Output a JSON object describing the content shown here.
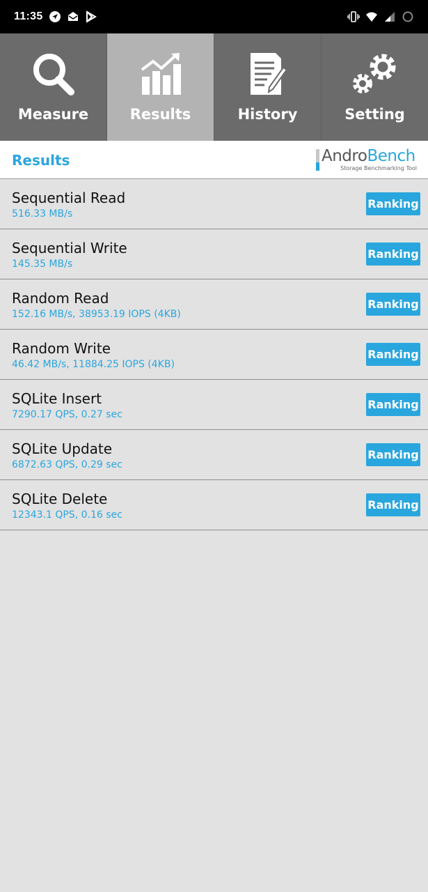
{
  "status_bar": {
    "time": "11:35",
    "icons_left": [
      "navigation-icon",
      "mail-icon",
      "play-store-icon"
    ],
    "icons_right": [
      "vibrate-icon",
      "wifi-icon",
      "signal-icon",
      "battery-icon"
    ]
  },
  "tabs": [
    {
      "label": "Measure",
      "icon": "magnifier-icon",
      "active": false
    },
    {
      "label": "Results",
      "icon": "chart-icon",
      "active": true
    },
    {
      "label": "History",
      "icon": "document-icon",
      "active": false
    },
    {
      "label": "Setting",
      "icon": "gears-icon",
      "active": false
    }
  ],
  "header": {
    "title": "Results",
    "logo_andro": "Andro",
    "logo_bench": "Bench",
    "logo_tagline": "Storage Benchmarking Tool"
  },
  "results": [
    {
      "name": "Sequential Read",
      "value": "516.33 MB/s",
      "button": "Ranking"
    },
    {
      "name": "Sequential Write",
      "value": "145.35 MB/s",
      "button": "Ranking"
    },
    {
      "name": "Random Read",
      "value": "152.16 MB/s, 38953.19 IOPS (4KB)",
      "button": "Ranking"
    },
    {
      "name": "Random Write",
      "value": "46.42 MB/s, 11884.25 IOPS (4KB)",
      "button": "Ranking"
    },
    {
      "name": "SQLite Insert",
      "value": "7290.17 QPS, 0.27 sec",
      "button": "Ranking"
    },
    {
      "name": "SQLite Update",
      "value": "6872.63 QPS, 0.29 sec",
      "button": "Ranking"
    },
    {
      "name": "SQLite Delete",
      "value": "12343.1 QPS, 0.16 sec",
      "button": "Ranking"
    }
  ],
  "colors": {
    "accent": "#2aa6de",
    "tab_bg": "#6b6b6b",
    "tab_active_bg": "#b3b3b3",
    "list_bg": "#e2e2e2"
  }
}
